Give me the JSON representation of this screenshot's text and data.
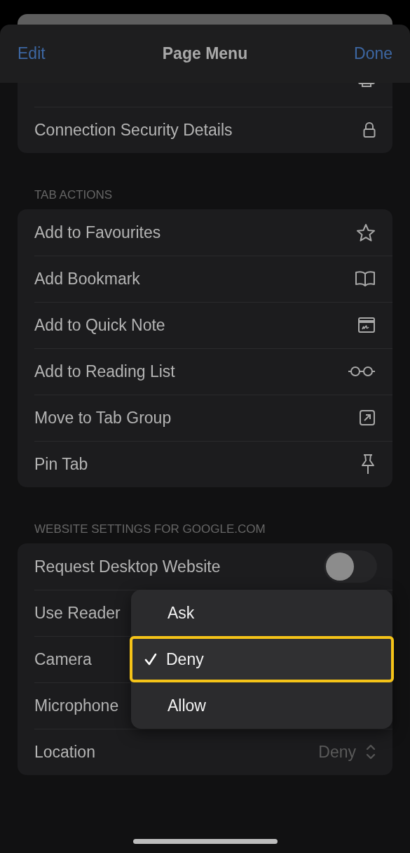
{
  "header": {
    "left_button": "Edit",
    "title": "Page Menu",
    "right_button": "Done"
  },
  "groups": [
    {
      "rows": [
        {
          "label": "Connection Security Details"
        }
      ]
    },
    {
      "title": "TAB ACTIONS",
      "rows": [
        {
          "label": "Add to Favourites"
        },
        {
          "label": "Add Bookmark"
        },
        {
          "label": "Add to Quick Note"
        },
        {
          "label": "Add to Reading List"
        },
        {
          "label": "Move to Tab Group"
        },
        {
          "label": "Pin Tab"
        }
      ]
    }
  ],
  "website_settings": {
    "title": "WEBSITE SETTINGS FOR GOOGLE.COM",
    "rows": [
      {
        "kind": "toggle",
        "label": "Request Desktop Website",
        "on": false
      },
      {
        "kind": "select",
        "label": "Use Reader"
      },
      {
        "kind": "select",
        "label": "Camera"
      },
      {
        "kind": "select",
        "label": "Microphone"
      },
      {
        "kind": "select",
        "label": "Location",
        "value": "Deny"
      }
    ]
  },
  "popup_menu": {
    "options": [
      {
        "label": "Ask",
        "selected": false
      },
      {
        "label": "Deny",
        "selected": true
      },
      {
        "label": "Allow",
        "selected": false
      }
    ]
  }
}
